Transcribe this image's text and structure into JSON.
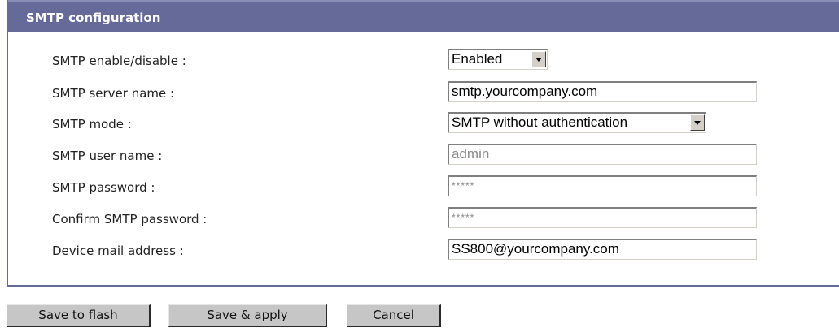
{
  "panel": {
    "title": "SMTP configuration"
  },
  "fields": {
    "enable": {
      "label": "SMTP enable/disable :",
      "value": "Enabled"
    },
    "server": {
      "label": "SMTP server name :",
      "value": "smtp.yourcompany.com"
    },
    "mode": {
      "label": "SMTP mode :",
      "value": "SMTP without authentication"
    },
    "user": {
      "label": "SMTP user name :",
      "value": "admin"
    },
    "password": {
      "label": "SMTP password :",
      "value": "*****"
    },
    "confirm": {
      "label": "Confirm SMTP password :",
      "value": "*****"
    },
    "mail": {
      "label": "Device mail address :",
      "value": "SS800@yourcompany.com"
    }
  },
  "buttons": {
    "save_flash": "Save to flash",
    "save_apply": "Save & apply",
    "cancel": "Cancel"
  },
  "colors": {
    "header_bg": "#666a99",
    "header_text": "#ffffff",
    "button_bg": "#c6c6c6",
    "disabled_text": "#8a8a8a"
  }
}
